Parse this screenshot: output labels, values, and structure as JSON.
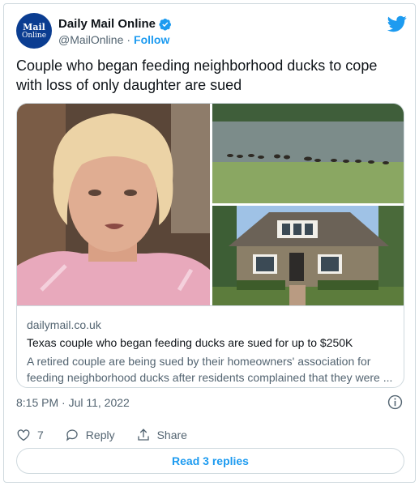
{
  "account": {
    "avatar_line1": "Mail",
    "avatar_line2": "Online",
    "name": "Daily Mail Online",
    "handle": "@MailOnline",
    "separator": "·",
    "follow_label": "Follow"
  },
  "tweet": {
    "text": "Couple who began feeding neighborhood ducks to cope with loss of only daughter are sued"
  },
  "link_card": {
    "domain": "dailymail.co.uk",
    "title": "Texas couple who began feeding ducks are sued for up to $250K",
    "description": "A retired couple are being sued by their homeowners' association for feeding neighborhood ducks after residents complained that they were ..."
  },
  "timestamp": "8:15 PM · Jul 11, 2022",
  "actions": {
    "like_count": "7",
    "reply_label": "Reply",
    "share_label": "Share"
  },
  "replies_button": "Read 3 replies",
  "colors": {
    "accent": "#1d9bf0",
    "text": "#0f1419",
    "muted": "#536471",
    "border": "#cfd9de",
    "avatar_bg": "#0b3d91"
  },
  "icons": [
    "avatar-logo",
    "verified-badge-icon",
    "twitter-bird-icon",
    "info-icon",
    "heart-icon",
    "reply-bubble-icon",
    "share-icon"
  ]
}
